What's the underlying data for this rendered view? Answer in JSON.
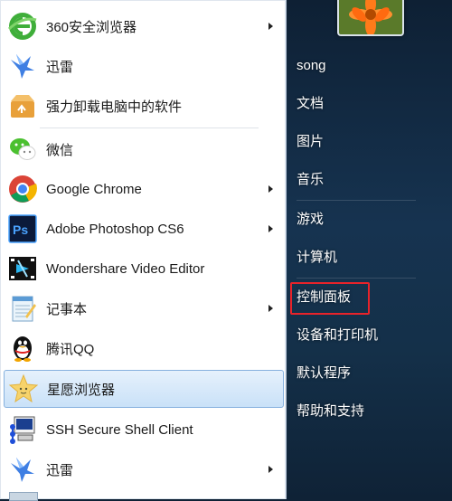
{
  "programs": [
    {
      "id": "360",
      "label": "360安全浏览器",
      "icon": "360-browser-icon",
      "arrow": true
    },
    {
      "id": "xunlei1",
      "label": "迅雷",
      "icon": "xunlei-bird-icon",
      "arrow": false
    },
    {
      "id": "uninstall",
      "label": "强力卸载电脑中的软件",
      "icon": "uninstall-box-icon",
      "arrow": false
    },
    {
      "id": "wechat",
      "label": "微信",
      "icon": "wechat-icon",
      "arrow": false
    },
    {
      "id": "chrome",
      "label": "Google Chrome",
      "icon": "chrome-icon",
      "arrow": true
    },
    {
      "id": "photoshop",
      "label": "Adobe Photoshop CS6",
      "icon": "photoshop-icon",
      "arrow": true
    },
    {
      "id": "wondershare",
      "label": "Wondershare Video Editor",
      "icon": "video-editor-icon",
      "arrow": false
    },
    {
      "id": "notepad",
      "label": "记事本",
      "icon": "notepad-icon",
      "arrow": true
    },
    {
      "id": "qq",
      "label": "腾讯QQ",
      "icon": "qq-penguin-icon",
      "arrow": false
    },
    {
      "id": "xingyuan",
      "label": "星愿浏览器",
      "icon": "star-face-icon",
      "arrow": false,
      "selected": true
    },
    {
      "id": "ssh",
      "label": "SSH Secure Shell Client",
      "icon": "ssh-client-icon",
      "arrow": false
    },
    {
      "id": "xunlei2",
      "label": "迅雷",
      "icon": "xunlei-bird-icon",
      "arrow": true
    }
  ],
  "right_items": [
    {
      "id": "user",
      "label": "song"
    },
    {
      "id": "documents",
      "label": "文档"
    },
    {
      "id": "pictures",
      "label": "图片"
    },
    {
      "id": "music",
      "label": "音乐"
    },
    {
      "id": "games",
      "label": "游戏"
    },
    {
      "id": "computer",
      "label": "计算机"
    },
    {
      "id": "control-panel",
      "label": "控制面板",
      "highlighted": true
    },
    {
      "id": "devices",
      "label": "设备和打印机"
    },
    {
      "id": "default-programs",
      "label": "默认程序"
    },
    {
      "id": "help",
      "label": "帮助和支持"
    }
  ],
  "colors": {
    "highlight_border": "#e8232a",
    "selected_bg": "#c9e1f8",
    "panel_dark": "#163350"
  }
}
